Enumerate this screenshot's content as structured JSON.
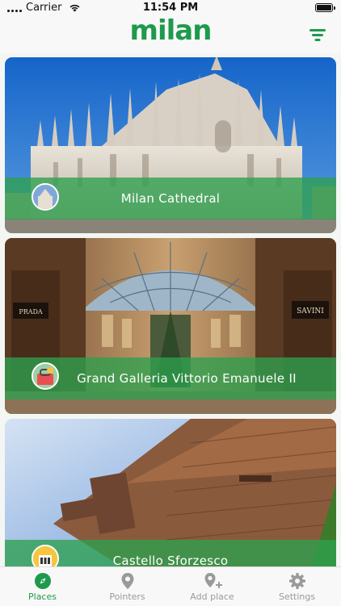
{
  "status_bar": {
    "carrier": "Carrier",
    "time": "11:54 PM"
  },
  "header": {
    "logo": "milan",
    "filter_icon": "filter-icon"
  },
  "places": [
    {
      "title": "Milan Cathedral",
      "badge_icon": "cathedral-thumbnail-icon"
    },
    {
      "title": "Grand Galleria Vittorio Emanuele II",
      "badge_icon": "shopping-icon"
    },
    {
      "title": "Castello Sforzesco",
      "badge_icon": "castle-icon"
    }
  ],
  "tabs": [
    {
      "label": "Places",
      "icon": "places-icon",
      "active": true
    },
    {
      "label": "Pointers",
      "icon": "map-pin-icon",
      "active": false
    },
    {
      "label": "Add place",
      "icon": "add-location-icon",
      "active": false
    },
    {
      "label": "Settings",
      "icon": "gear-icon",
      "active": false
    }
  ],
  "colors": {
    "accent": "#1e9a4c",
    "banner": "#2ea04e",
    "inactive_tab": "#9a9a9a"
  }
}
